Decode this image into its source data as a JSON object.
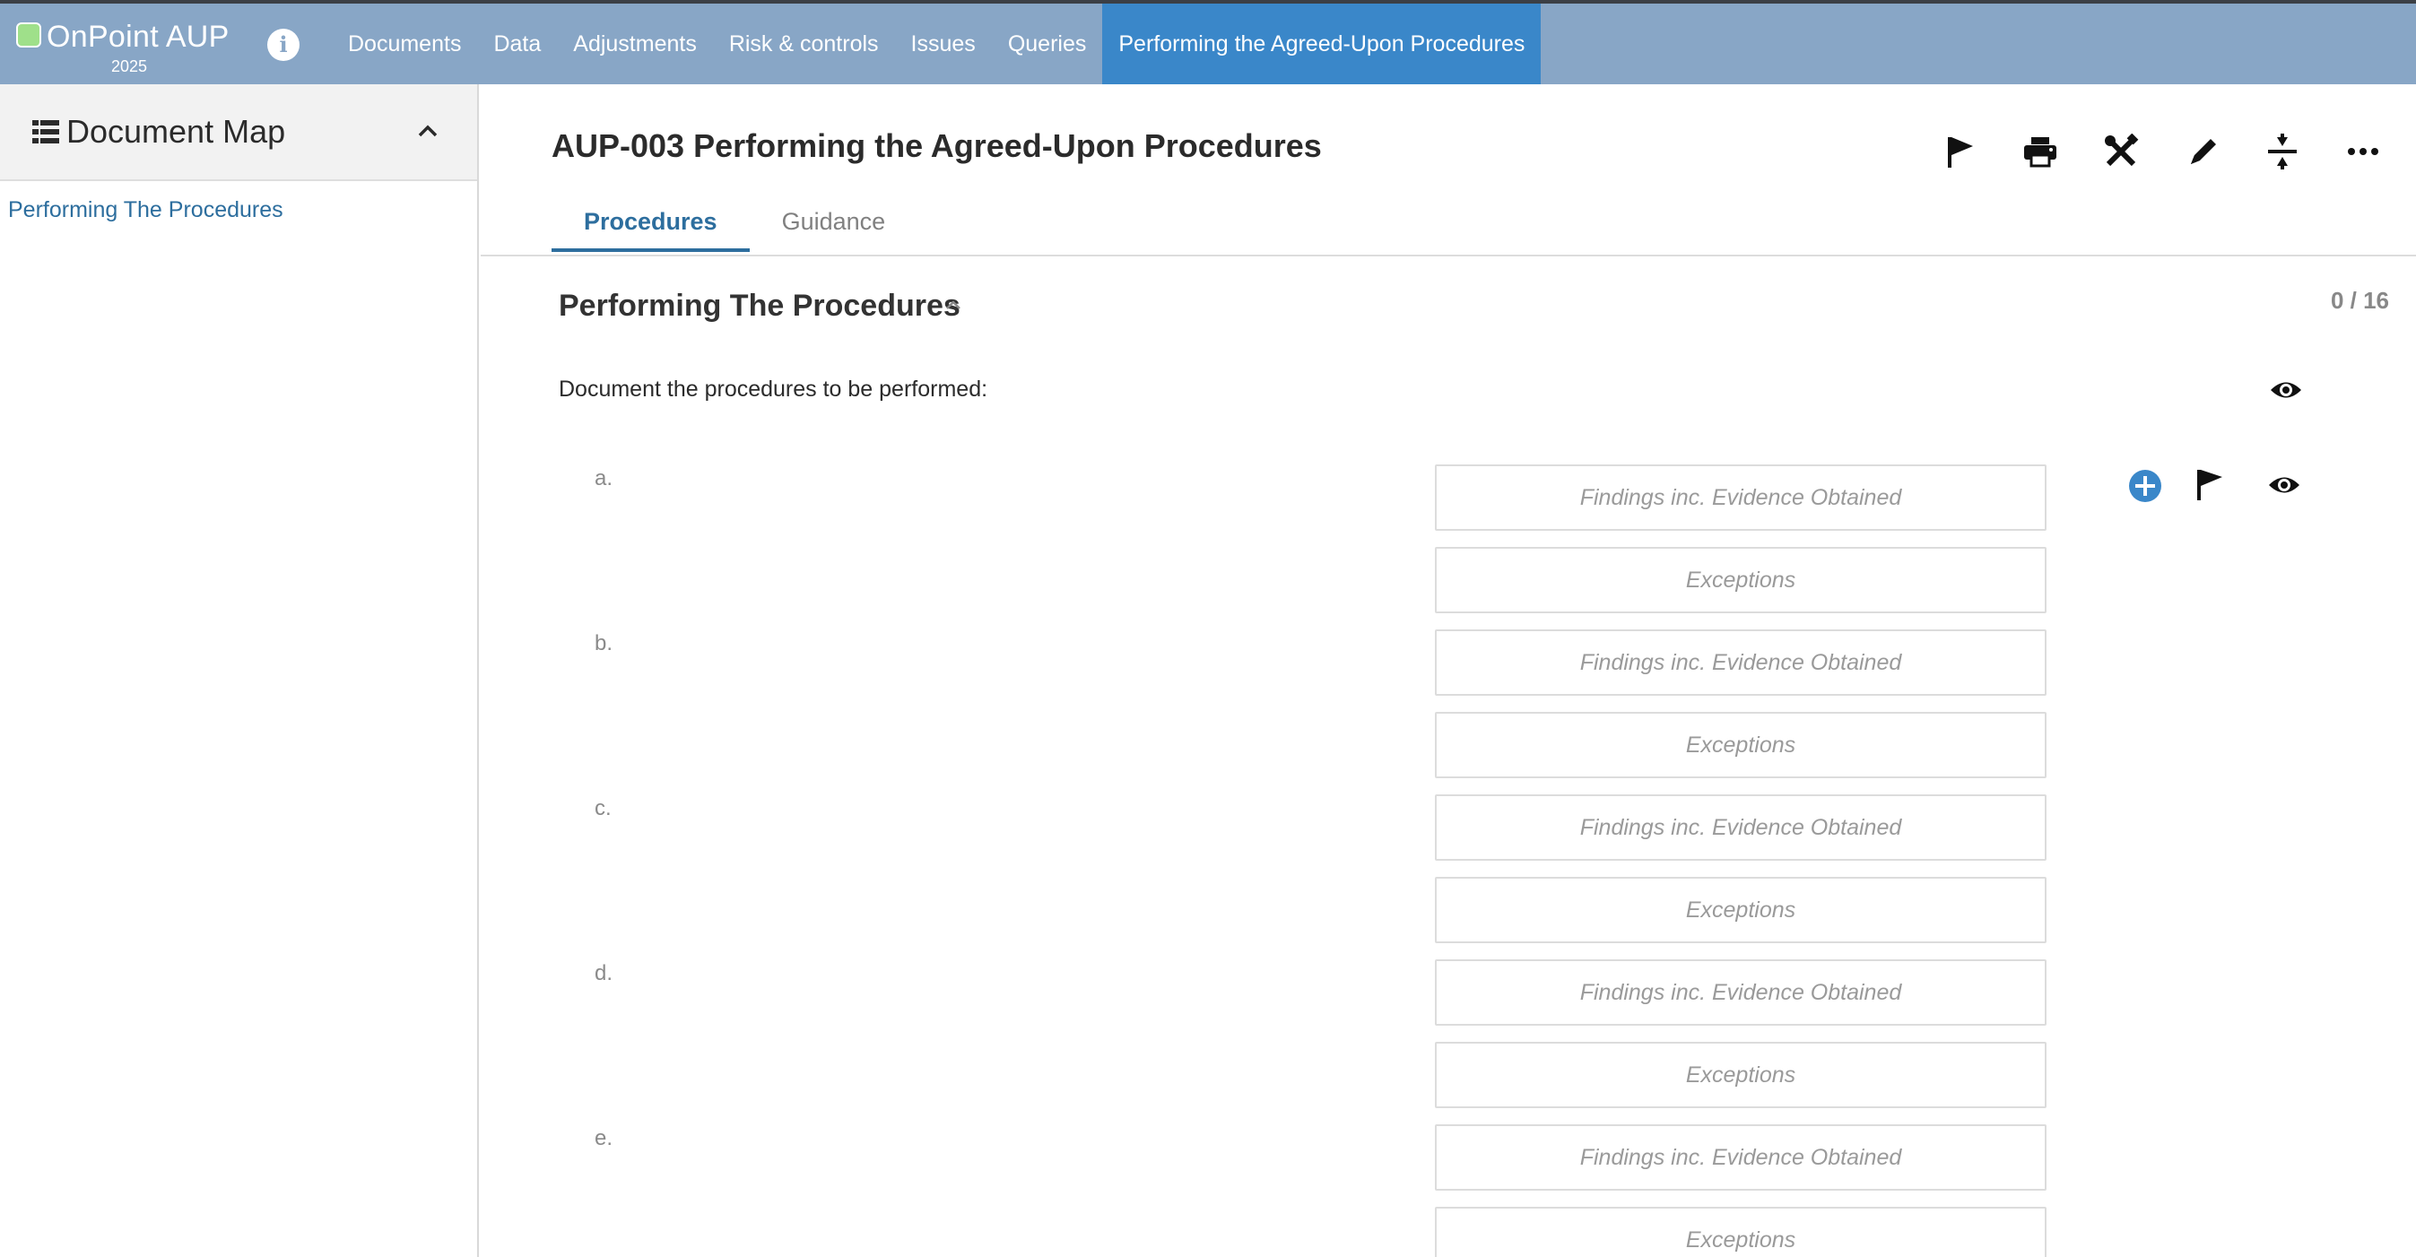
{
  "app": {
    "name": "OnPoint AUP",
    "year": "2025",
    "info_icon": "info-icon",
    "nav": [
      {
        "label": "Documents",
        "active": false
      },
      {
        "label": "Data",
        "active": false
      },
      {
        "label": "Adjustments",
        "active": false
      },
      {
        "label": "Risk & controls",
        "active": false
      },
      {
        "label": "Issues",
        "active": false
      },
      {
        "label": "Queries",
        "active": false
      },
      {
        "label": "Performing the Agreed-Upon Procedures",
        "active": true
      }
    ],
    "colors": {
      "topbar": "#88a6c6",
      "active_tab": "#3a87c9",
      "link": "#2d6e9e",
      "add_icon": "#3a87c9"
    }
  },
  "sidebar": {
    "title": "Document Map",
    "items": [
      {
        "label": "Performing The Procedures"
      }
    ]
  },
  "document": {
    "title": "AUP-003 Performing the Agreed-Upon Procedures",
    "toolbar": [
      "flag-icon",
      "print-icon",
      "tools-icon",
      "edit-icon",
      "collapse-all-icon",
      "more-icon"
    ],
    "tabs": [
      {
        "label": "Procedures",
        "active": true
      },
      {
        "label": "Guidance",
        "active": false
      }
    ],
    "section": {
      "title": "Performing The Procedures",
      "progress": "0 / 16",
      "instruction": "Document the procedures to be performed:",
      "procedures": [
        {
          "label": "a.",
          "findings_placeholder": "Findings inc. Evidence Obtained",
          "exceptions_placeholder": "Exceptions"
        },
        {
          "label": "b.",
          "findings_placeholder": "Findings inc. Evidence Obtained",
          "exceptions_placeholder": "Exceptions"
        },
        {
          "label": "c.",
          "findings_placeholder": "Findings inc. Evidence Obtained",
          "exceptions_placeholder": "Exceptions"
        },
        {
          "label": "d.",
          "findings_placeholder": "Findings inc. Evidence Obtained",
          "exceptions_placeholder": "Exceptions"
        },
        {
          "label": "e.",
          "findings_placeholder": "Findings inc. Evidence Obtained",
          "exceptions_placeholder": "Exceptions"
        }
      ]
    }
  }
}
